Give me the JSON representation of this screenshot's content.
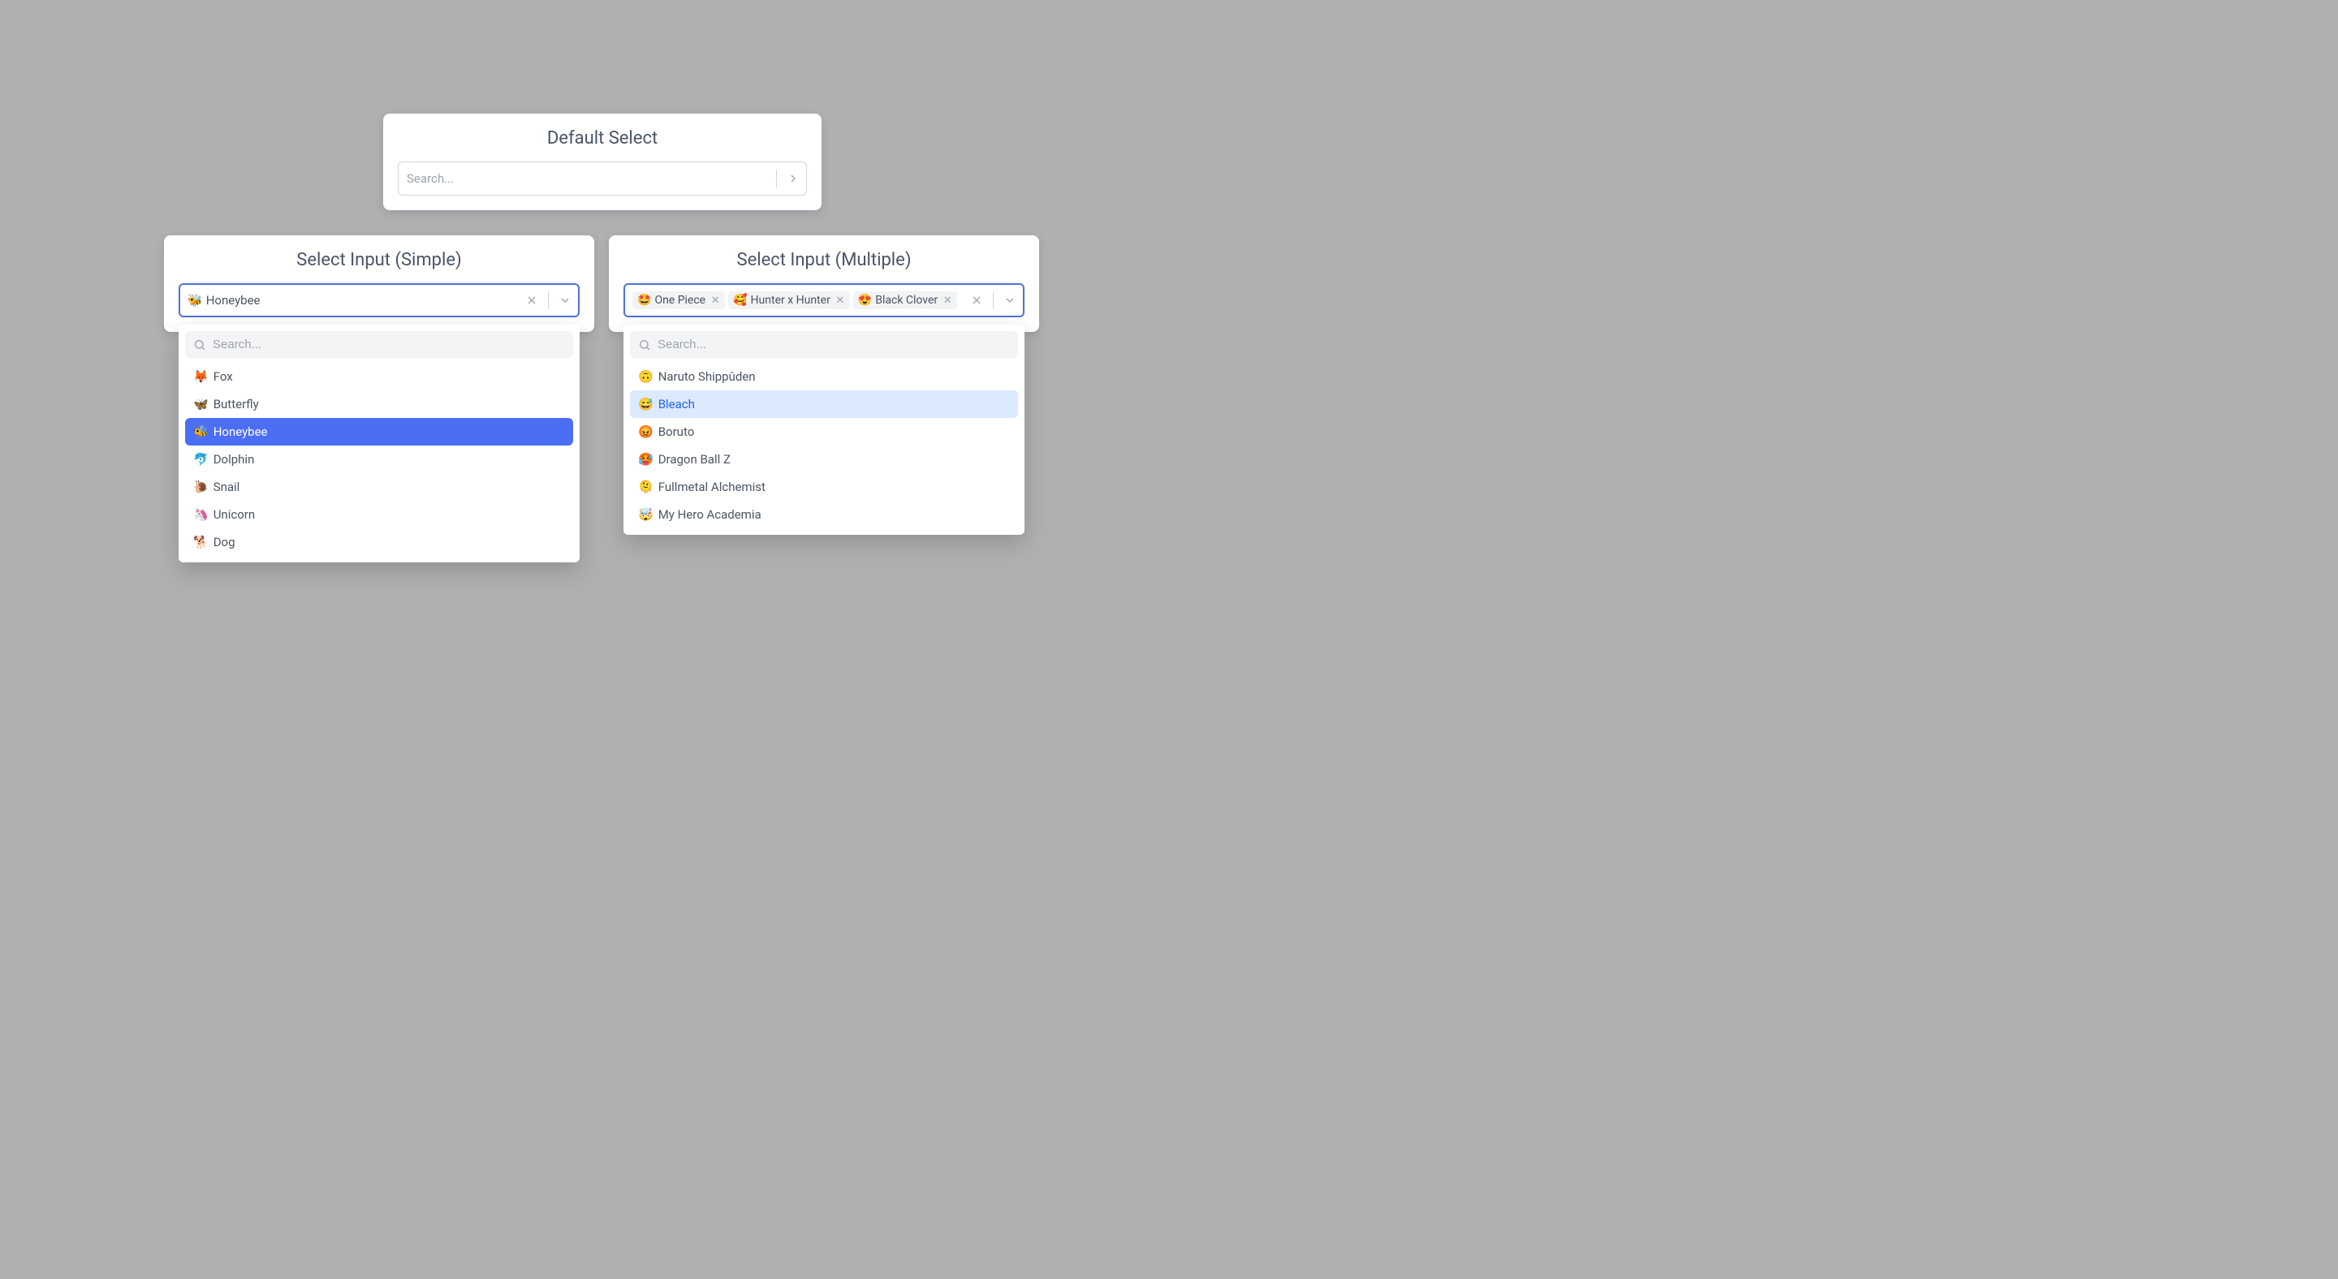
{
  "default_select": {
    "title": "Default Select",
    "placeholder": "Search..."
  },
  "simple_select": {
    "title": "Select Input (Simple)",
    "value_emoji": "🐝",
    "value_label": "Honeybee",
    "search_placeholder": "Search...",
    "options": [
      {
        "emoji": "🦊",
        "label": "Fox",
        "state": ""
      },
      {
        "emoji": "🦋",
        "label": "Butterfly",
        "state": ""
      },
      {
        "emoji": "🐝",
        "label": "Honeybee",
        "state": "selected"
      },
      {
        "emoji": "🐬",
        "label": "Dolphin",
        "state": ""
      },
      {
        "emoji": "🐌",
        "label": "Snail",
        "state": ""
      },
      {
        "emoji": "🦄",
        "label": "Unicorn",
        "state": ""
      },
      {
        "emoji": "🐕",
        "label": "Dog",
        "state": ""
      }
    ]
  },
  "multiple_select": {
    "title": "Select Input (Multiple)",
    "search_placeholder": "Search...",
    "tags": [
      {
        "emoji": "🤩",
        "label": "One Piece"
      },
      {
        "emoji": "🥰",
        "label": "Hunter x Hunter"
      },
      {
        "emoji": "😍",
        "label": "Black Clover"
      }
    ],
    "options": [
      {
        "emoji": "🙃",
        "label": "Naruto Shippûden",
        "state": ""
      },
      {
        "emoji": "😅",
        "label": "Bleach",
        "state": "hovered"
      },
      {
        "emoji": "😡",
        "label": "Boruto",
        "state": ""
      },
      {
        "emoji": "🥵",
        "label": "Dragon Ball Z",
        "state": ""
      },
      {
        "emoji": "🫠",
        "label": "Fullmetal Alchemist",
        "state": ""
      },
      {
        "emoji": "🤯",
        "label": "My Hero Academia",
        "state": ""
      }
    ]
  }
}
